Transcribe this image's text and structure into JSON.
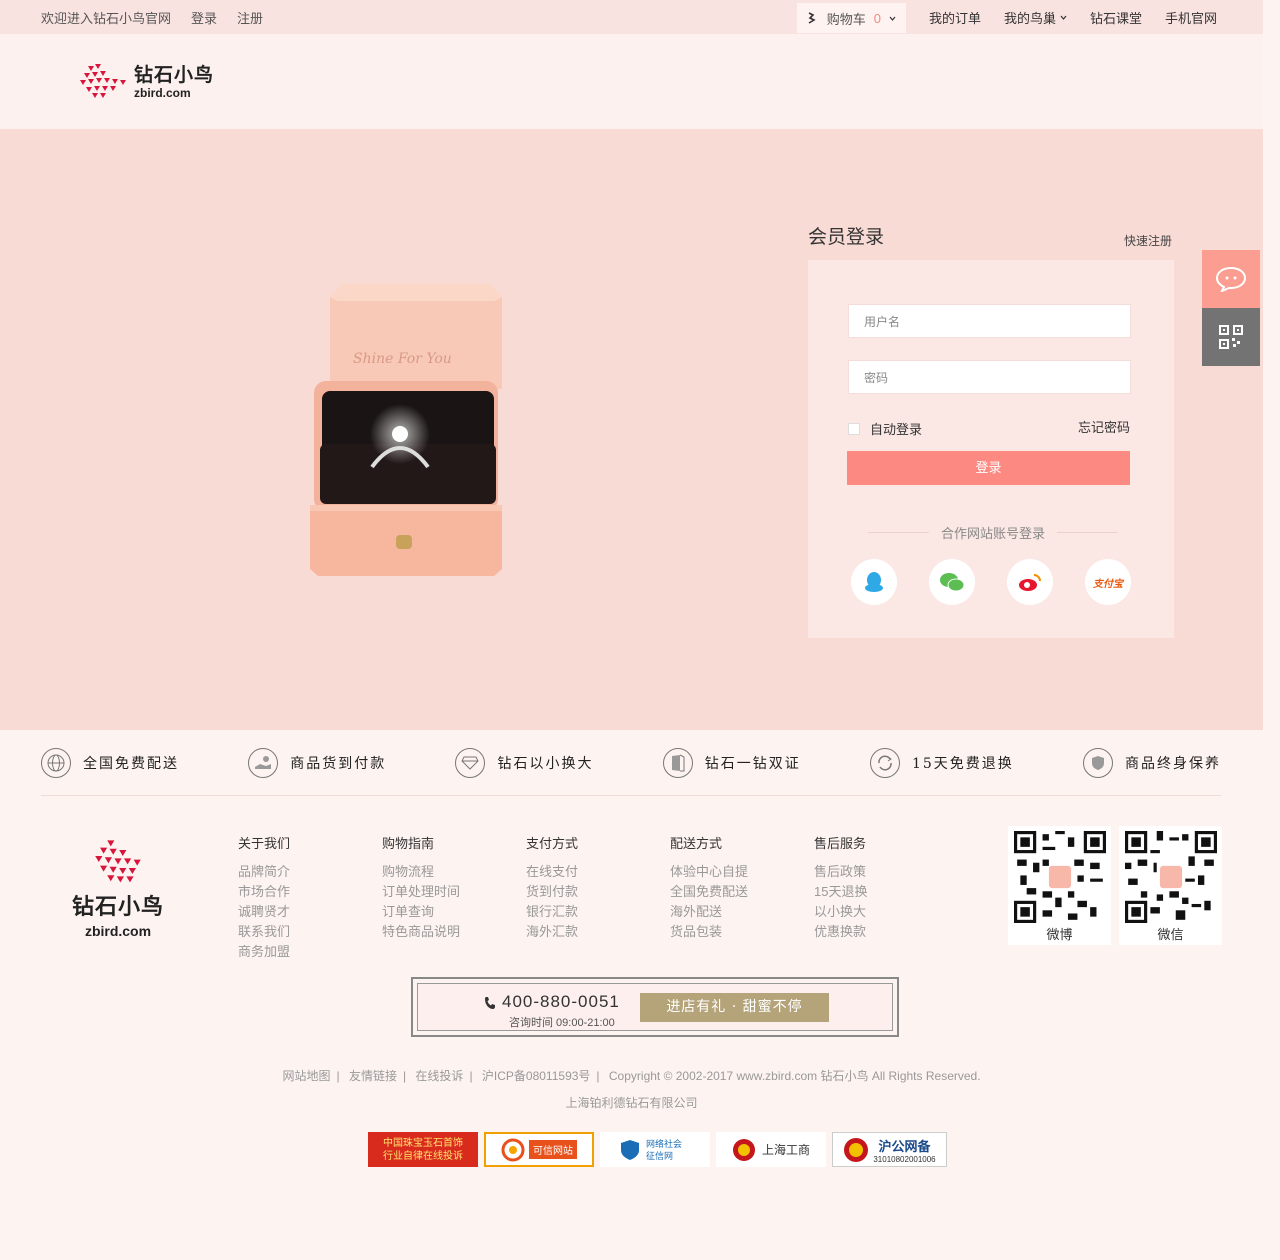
{
  "topbar": {
    "welcome": "欢迎进入钻石小鸟官网",
    "login": "登录",
    "register": "注册",
    "cart_label": "购物车",
    "cart_count": "0",
    "my_orders": "我的订单",
    "my_nest": "我的鸟巢",
    "class": "钻石课堂",
    "mobile": "手机官网"
  },
  "brand": {
    "cn": "钻石小鸟",
    "en": "zbird.com"
  },
  "ring_box_text": "Shine For You",
  "login": {
    "title": "会员登录",
    "quick_register": "快速注册",
    "username_placeholder": "用户名",
    "password_placeholder": "密码",
    "auto_login": "自动登录",
    "forgot": "忘记密码",
    "submit": "登录",
    "partner": "合作网站账号登录",
    "alipay": "支付宝"
  },
  "features": [
    {
      "label": "全国免费配送",
      "icon": "globe-icon"
    },
    {
      "label": "商品货到付款",
      "icon": "cash-icon"
    },
    {
      "label": "钻石以小换大",
      "icon": "diamond-icon"
    },
    {
      "label": "钻石一钻双证",
      "icon": "certificate-icon"
    },
    {
      "label": "15天免费退换",
      "icon": "refresh-icon"
    },
    {
      "label": "商品终身保养",
      "icon": "shield-icon"
    }
  ],
  "footer": {
    "columns": [
      {
        "title": "关于我们",
        "items": [
          "品牌简介",
          "市场合作",
          "诚聘贤才",
          "联系我们",
          "商务加盟"
        ]
      },
      {
        "title": "购物指南",
        "items": [
          "购物流程",
          "订单处理时间",
          "订单查询",
          "特色商品说明"
        ]
      },
      {
        "title": "支付方式",
        "items": [
          "在线支付",
          "货到付款",
          "银行汇款",
          "海外汇款"
        ]
      },
      {
        "title": "配送方式",
        "items": [
          "体验中心自提",
          "全国免费配送",
          "海外配送",
          "货品包装"
        ]
      },
      {
        "title": "售后服务",
        "items": [
          "售后政策",
          "15天退换",
          "以小换大",
          "优惠换款"
        ]
      }
    ],
    "qr": [
      {
        "label": "微博"
      },
      {
        "label": "微信"
      }
    ],
    "phone": "400-880-0051",
    "hours": "咨询时间 09:00-21:00",
    "gift": "进店有礼 · 甜蜜不停",
    "links": [
      "网站地图",
      "友情链接",
      "在线投诉",
      "沪ICP备08011593号",
      "Copyright © 2002-2017 www.zbird.com  钻石小鸟  All Rights Reserved."
    ],
    "company": "上海铂利德钻石有限公司",
    "badges": [
      "中国珠宝玉石首饰行业自律在线投诉",
      "可信网站",
      "网络社会征信网",
      "上海工商",
      "沪公网备",
      "31010802001006"
    ]
  },
  "colors": {
    "accent": "#fd8a82",
    "main_bg": "#f9dbd6",
    "topbar_bg": "#f9e3e0",
    "gold": "#b5a47a"
  }
}
